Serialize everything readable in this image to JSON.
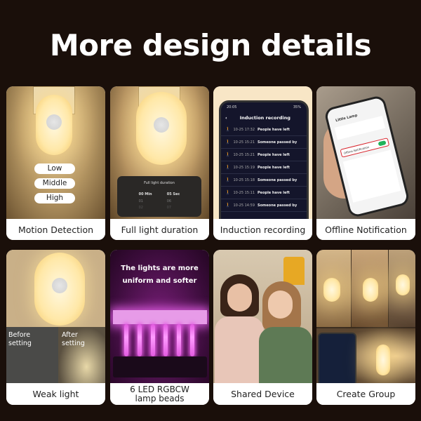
{
  "title": "More design details",
  "cards": [
    {
      "caption": "Motion Detection",
      "levels": [
        "Low",
        "Middle",
        "High"
      ]
    },
    {
      "caption": "Full light duration",
      "panel": {
        "title": "Full light duration",
        "min_label": "00 Min",
        "sec_label": "05 Sec",
        "min_next": [
          "01",
          "02"
        ],
        "sec_next": [
          "06",
          "07"
        ]
      }
    },
    {
      "caption": "Induction recording",
      "phone": {
        "status_time": "20:05",
        "battery": "35%",
        "screen_title": "Induction recording",
        "records": [
          {
            "time": "10-25 17:32",
            "event": "People have left"
          },
          {
            "time": "10-25 15:21",
            "event": "Someone passed by"
          },
          {
            "time": "10-25 15:21",
            "event": "People have left"
          },
          {
            "time": "10-25 15:19",
            "event": "People have left"
          },
          {
            "time": "10-25 15:18",
            "event": "Someone passed by"
          },
          {
            "time": "10-25 15:11",
            "event": "People have left"
          },
          {
            "time": "10-25 14:59",
            "event": "Someone passed by"
          }
        ]
      }
    },
    {
      "caption": "Offline Notification",
      "phone": {
        "device_name": "Little Lamp",
        "highlighted_setting": "Offline Notification",
        "toggle_on": true,
        "toggle_color": "#22b35a",
        "highlight_color": "#d8262e"
      }
    },
    {
      "caption": "Weak light",
      "before_label": "Before setting",
      "after_label": "After setting"
    },
    {
      "caption": "6 LED RGBCW lamp beads",
      "caption_lines": [
        "6 LED RGBCW",
        "lamp beads"
      ],
      "headline_lines": [
        "The lights are more",
        "uniform and softer"
      ],
      "led_count": 6,
      "led_color": "#e25ae0"
    },
    {
      "caption": "Shared Device"
    },
    {
      "caption": "Create Group"
    }
  ]
}
